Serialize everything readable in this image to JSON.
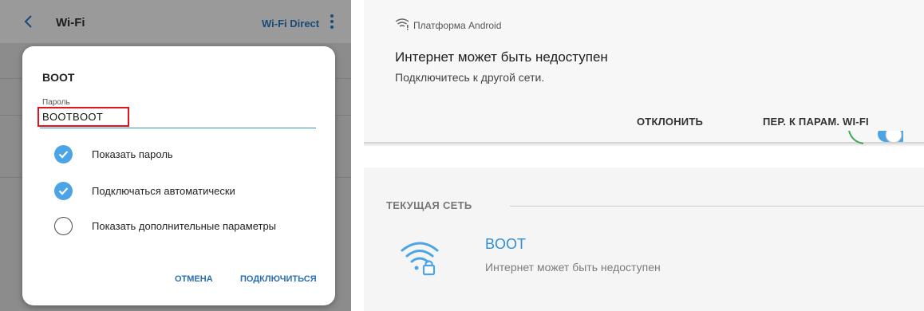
{
  "left_panel": {
    "header": {
      "title": "Wi-Fi",
      "wifi_direct_label": "Wi-Fi Direct"
    },
    "dialog": {
      "network_name": "BOOT",
      "password_label": "Пароль",
      "password_value": "BOOTBOOT",
      "options": [
        {
          "label": "Показать пароль",
          "checked": true
        },
        {
          "label": "Подключаться автоматически",
          "checked": true
        },
        {
          "label": "Показать дополнительные параметры",
          "checked": false
        }
      ],
      "cancel_label": "ОТМЕНА",
      "connect_label": "ПОДКЛЮЧИТЬСЯ"
    }
  },
  "right_panel": {
    "notification": {
      "app_name": "Платформа Android",
      "title": "Интернет может быть недоступен",
      "subtitle": "Подключитесь к другой сети.",
      "dismiss_label": "ОТКЛОНИТЬ",
      "settings_label": "ПЕР. К ПАРАМ. WI-FI"
    },
    "current_network": {
      "section_label": "ТЕКУЩАЯ СЕТЬ",
      "name": "BOOT",
      "status": "Интернет может быть недоступен"
    }
  },
  "colors": {
    "accent_blue": "#2f8ed6",
    "check_blue": "#4ba4e6",
    "highlight_red": "#e0131f",
    "button_blue": "#2a6fb0"
  }
}
